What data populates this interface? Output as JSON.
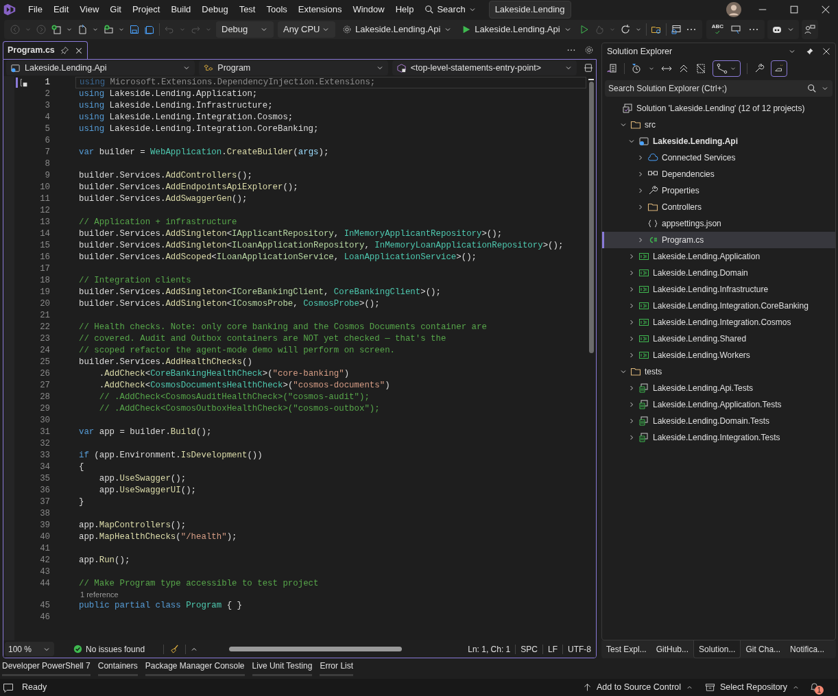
{
  "title_bar": {
    "menu": [
      "File",
      "Edit",
      "View",
      "Git",
      "Project",
      "Build",
      "Debug",
      "Test",
      "Tools",
      "Extensions",
      "Window",
      "Help"
    ],
    "search": "Search",
    "solution_name": "Lakeside.Lending"
  },
  "toolbar": {
    "configuration": "Debug",
    "platform": "Any CPU",
    "startup_project": "Lakeside.Lending.Api",
    "run_target": "Lakeside.Lending.Api",
    "spell_check": "ABC"
  },
  "editor": {
    "tab": {
      "label": "Program.cs",
      "selected": true
    },
    "nav": [
      "Lakeside.Lending.Api",
      "Program",
      "<top-level-statements-entry-point>"
    ],
    "lines": [
      {
        "kind": "code",
        "number": "1",
        "current": true,
        "tokens": [
          {
            "kind": "faded-keyword",
            "text": "using"
          },
          {
            "kind": "faded",
            "text": " Microsoft.Extensions.DependencyInjection.Extensions;"
          }
        ]
      },
      {
        "kind": "code",
        "number": "2",
        "current": false,
        "tokens": [
          {
            "kind": "keyword",
            "text": "using"
          },
          {
            "kind": "plain",
            "text": " Lakeside.Lending.Application;"
          }
        ]
      },
      {
        "kind": "code",
        "number": "3",
        "current": false,
        "tokens": [
          {
            "kind": "keyword",
            "text": "using"
          },
          {
            "kind": "plain",
            "text": " Lakeside.Lending.Infrastructure;"
          }
        ]
      },
      {
        "kind": "code",
        "number": "4",
        "current": false,
        "tokens": [
          {
            "kind": "keyword",
            "text": "using"
          },
          {
            "kind": "plain",
            "text": " Lakeside.Lending.Integration.Cosmos;"
          }
        ]
      },
      {
        "kind": "code",
        "number": "5",
        "current": false,
        "tokens": [
          {
            "kind": "keyword",
            "text": "using"
          },
          {
            "kind": "plain",
            "text": " Lakeside.Lending.Integration.CoreBanking;"
          }
        ]
      },
      {
        "kind": "code",
        "number": "6",
        "current": false
      },
      {
        "kind": "code",
        "number": "7",
        "current": false,
        "tokens": [
          {
            "kind": "keyword",
            "text": "var"
          },
          {
            "kind": "plain",
            "text": " builder = "
          },
          {
            "kind": "type",
            "text": "WebApplication"
          },
          {
            "kind": "plain",
            "text": "."
          },
          {
            "kind": "method",
            "text": "CreateBuilder"
          },
          {
            "kind": "plain",
            "text": "("
          },
          {
            "kind": "param",
            "text": "args"
          },
          {
            "kind": "plain",
            "text": ");"
          }
        ]
      },
      {
        "kind": "code",
        "number": "8",
        "current": false
      },
      {
        "kind": "code",
        "number": "9",
        "current": false,
        "tokens": [
          {
            "kind": "plain",
            "text": "builder.Services."
          },
          {
            "kind": "method",
            "text": "AddControllers"
          },
          {
            "kind": "plain",
            "text": "();"
          }
        ]
      },
      {
        "kind": "code",
        "number": "10",
        "current": false,
        "tokens": [
          {
            "kind": "plain",
            "text": "builder.Services."
          },
          {
            "kind": "method",
            "text": "AddEndpointsApiExplorer"
          },
          {
            "kind": "plain",
            "text": "();"
          }
        ]
      },
      {
        "kind": "code",
        "number": "11",
        "current": false,
        "tokens": [
          {
            "kind": "plain",
            "text": "builder.Services."
          },
          {
            "kind": "method",
            "text": "AddSwaggerGen"
          },
          {
            "kind": "plain",
            "text": "();"
          }
        ]
      },
      {
        "kind": "code",
        "number": "12",
        "current": false
      },
      {
        "kind": "code",
        "number": "13",
        "current": false,
        "tokens": [
          {
            "kind": "comment",
            "text": "// Application + infrastructure"
          }
        ]
      },
      {
        "kind": "code",
        "number": "14",
        "current": false,
        "tokens": [
          {
            "kind": "plain",
            "text": "builder.Services."
          },
          {
            "kind": "method",
            "text": "AddSingleton"
          },
          {
            "kind": "plain",
            "text": "<"
          },
          {
            "kind": "interface",
            "text": "IApplicantRepository"
          },
          {
            "kind": "plain",
            "text": ", "
          },
          {
            "kind": "type",
            "text": "InMemoryApplicantRepository"
          },
          {
            "kind": "plain",
            "text": ">();"
          }
        ]
      },
      {
        "kind": "code",
        "number": "15",
        "current": false,
        "tokens": [
          {
            "kind": "plain",
            "text": "builder.Services."
          },
          {
            "kind": "method",
            "text": "AddSingleton"
          },
          {
            "kind": "plain",
            "text": "<"
          },
          {
            "kind": "interface",
            "text": "ILoanApplicationRepository"
          },
          {
            "kind": "plain",
            "text": ", "
          },
          {
            "kind": "type",
            "text": "InMemoryLoanApplicationRepository"
          },
          {
            "kind": "plain",
            "text": ">();"
          }
        ]
      },
      {
        "kind": "code",
        "number": "16",
        "current": false,
        "tokens": [
          {
            "kind": "plain",
            "text": "builder.Services."
          },
          {
            "kind": "method",
            "text": "AddScoped"
          },
          {
            "kind": "plain",
            "text": "<"
          },
          {
            "kind": "interface",
            "text": "ILoanApplicationService"
          },
          {
            "kind": "plain",
            "text": ", "
          },
          {
            "kind": "type",
            "text": "LoanApplicationService"
          },
          {
            "kind": "plain",
            "text": ">();"
          }
        ]
      },
      {
        "kind": "code",
        "number": "17",
        "current": false
      },
      {
        "kind": "code",
        "number": "18",
        "current": false,
        "tokens": [
          {
            "kind": "comment",
            "text": "// Integration clients"
          }
        ]
      },
      {
        "kind": "code",
        "number": "19",
        "current": false,
        "tokens": [
          {
            "kind": "plain",
            "text": "builder.Services."
          },
          {
            "kind": "method",
            "text": "AddSingleton"
          },
          {
            "kind": "plain",
            "text": "<"
          },
          {
            "kind": "interface",
            "text": "ICoreBankingClient"
          },
          {
            "kind": "plain",
            "text": ", "
          },
          {
            "kind": "type",
            "text": "CoreBankingClient"
          },
          {
            "kind": "plain",
            "text": ">();"
          }
        ]
      },
      {
        "kind": "code",
        "number": "20",
        "current": false,
        "tokens": [
          {
            "kind": "plain",
            "text": "builder.Services."
          },
          {
            "kind": "method",
            "text": "AddSingleton"
          },
          {
            "kind": "plain",
            "text": "<"
          },
          {
            "kind": "interface",
            "text": "ICosmosProbe"
          },
          {
            "kind": "plain",
            "text": ", "
          },
          {
            "kind": "type",
            "text": "CosmosProbe"
          },
          {
            "kind": "plain",
            "text": ">();"
          }
        ]
      },
      {
        "kind": "code",
        "number": "21",
        "current": false
      },
      {
        "kind": "code",
        "number": "22",
        "current": false,
        "tokens": [
          {
            "kind": "comment",
            "text": "// Health checks. Note: only core banking and the Cosmos Documents container are"
          }
        ]
      },
      {
        "kind": "code",
        "number": "23",
        "current": false,
        "tokens": [
          {
            "kind": "comment",
            "text": "// covered. Audit and Outbox containers are NOT yet checked — that's the"
          }
        ]
      },
      {
        "kind": "code",
        "number": "24",
        "current": false,
        "tokens": [
          {
            "kind": "comment",
            "text": "// scoped refactor the agent-mode demo will perform on screen."
          }
        ]
      },
      {
        "kind": "code",
        "number": "25",
        "current": false,
        "tokens": [
          {
            "kind": "plain",
            "text": "builder.Services."
          },
          {
            "kind": "method",
            "text": "AddHealthChecks"
          },
          {
            "kind": "plain",
            "text": "()"
          }
        ]
      },
      {
        "kind": "code",
        "number": "26",
        "current": false,
        "tokens": [
          {
            "kind": "plain",
            "text": "    ."
          },
          {
            "kind": "method",
            "text": "AddCheck"
          },
          {
            "kind": "plain",
            "text": "<"
          },
          {
            "kind": "type",
            "text": "CoreBankingHealthCheck"
          },
          {
            "kind": "plain",
            "text": ">("
          },
          {
            "kind": "string",
            "text": "\"core-banking\""
          },
          {
            "kind": "plain",
            "text": ")"
          }
        ]
      },
      {
        "kind": "code",
        "number": "27",
        "current": false,
        "tokens": [
          {
            "kind": "plain",
            "text": "    ."
          },
          {
            "kind": "method",
            "text": "AddCheck"
          },
          {
            "kind": "plain",
            "text": "<"
          },
          {
            "kind": "type",
            "text": "CosmosDocumentsHealthCheck"
          },
          {
            "kind": "plain",
            "text": ">("
          },
          {
            "kind": "string",
            "text": "\"cosmos-documents\""
          },
          {
            "kind": "plain",
            "text": ")"
          }
        ]
      },
      {
        "kind": "code",
        "number": "28",
        "current": false,
        "tokens": [
          {
            "kind": "comment",
            "text": "    // .AddCheck<CosmosAuditHealthCheck>(\"cosmos-audit\");"
          }
        ]
      },
      {
        "kind": "code",
        "number": "29",
        "current": false,
        "tokens": [
          {
            "kind": "comment",
            "text": "    // .AddCheck<CosmosOutboxHealthCheck>(\"cosmos-outbox\");"
          }
        ]
      },
      {
        "kind": "code",
        "number": "30",
        "current": false
      },
      {
        "kind": "code",
        "number": "31",
        "current": false,
        "tokens": [
          {
            "kind": "keyword",
            "text": "var"
          },
          {
            "kind": "plain",
            "text": " app = builder."
          },
          {
            "kind": "method",
            "text": "Build"
          },
          {
            "kind": "plain",
            "text": "();"
          }
        ]
      },
      {
        "kind": "code",
        "number": "32",
        "current": false
      },
      {
        "kind": "code",
        "number": "33",
        "current": false,
        "tokens": [
          {
            "kind": "keyword",
            "text": "if"
          },
          {
            "kind": "plain",
            "text": " (app.Environment."
          },
          {
            "kind": "method",
            "text": "IsDevelopment"
          },
          {
            "kind": "plain",
            "text": "())"
          }
        ]
      },
      {
        "kind": "code",
        "number": "34",
        "current": false,
        "tokens": [
          {
            "kind": "plain",
            "text": "{"
          }
        ]
      },
      {
        "kind": "code",
        "number": "35",
        "current": false,
        "tokens": [
          {
            "kind": "plain",
            "text": "    app."
          },
          {
            "kind": "method",
            "text": "UseSwagger"
          },
          {
            "kind": "plain",
            "text": "();"
          }
        ]
      },
      {
        "kind": "code",
        "number": "36",
        "current": false,
        "tokens": [
          {
            "kind": "plain",
            "text": "    app."
          },
          {
            "kind": "method",
            "text": "UseSwaggerUI"
          },
          {
            "kind": "plain",
            "text": "();"
          }
        ]
      },
      {
        "kind": "code",
        "number": "37",
        "current": false,
        "tokens": [
          {
            "kind": "plain",
            "text": "}"
          }
        ]
      },
      {
        "kind": "code",
        "number": "38",
        "current": false
      },
      {
        "kind": "code",
        "number": "39",
        "current": false,
        "tokens": [
          {
            "kind": "plain",
            "text": "app."
          },
          {
            "kind": "method",
            "text": "MapControllers"
          },
          {
            "kind": "plain",
            "text": "();"
          }
        ]
      },
      {
        "kind": "code",
        "number": "40",
        "current": false,
        "tokens": [
          {
            "kind": "plain",
            "text": "app."
          },
          {
            "kind": "method",
            "text": "MapHealthChecks"
          },
          {
            "kind": "plain",
            "text": "("
          },
          {
            "kind": "string",
            "text": "\"/health\""
          },
          {
            "kind": "plain",
            "text": ");"
          }
        ]
      },
      {
        "kind": "code",
        "number": "41",
        "current": false
      },
      {
        "kind": "code",
        "number": "42",
        "current": false,
        "tokens": [
          {
            "kind": "plain",
            "text": "app."
          },
          {
            "kind": "method",
            "text": "Run"
          },
          {
            "kind": "plain",
            "text": "();"
          }
        ]
      },
      {
        "kind": "code",
        "number": "43",
        "current": false
      },
      {
        "kind": "code",
        "number": "44",
        "current": false,
        "tokens": [
          {
            "kind": "comment",
            "text": "// Make Program type accessible to test project"
          }
        ]
      },
      {
        "kind": "codelens",
        "text": "1 reference"
      },
      {
        "kind": "code",
        "number": "45",
        "current": false,
        "tokens": [
          {
            "kind": "keyword",
            "text": "public partial class "
          },
          {
            "kind": "type",
            "text": "Program"
          },
          {
            "kind": "plain",
            "text": " { }"
          }
        ]
      },
      {
        "kind": "code",
        "number": "46",
        "current": false
      }
    ]
  },
  "editor_status": {
    "zoom": "100 %",
    "issues": "No issues found",
    "position": "Ln: 1, Ch: 1",
    "indent": "SPC",
    "line_ending": "LF",
    "encoding": "UTF-8"
  },
  "solution_explorer": {
    "title": "Solution Explorer",
    "search_placeholder": "Search Solution Explorer (Ctrl+;)",
    "tree": [
      {
        "kind": "solution",
        "label": "Solution 'Lakeside.Lending' (12 of 12 projects)",
        "selected": false,
        "children": [
          {
            "kind": "folder",
            "label": "src",
            "selected": false,
            "expanded": true,
            "children": [
              {
                "kind": "webproject",
                "label": "Lakeside.Lending.Api",
                "selected": false,
                "expanded": true,
                "startup": true,
                "children": [
                  {
                    "kind": "connected",
                    "label": "Connected Services",
                    "selected": false,
                    "expanded": false
                  },
                  {
                    "kind": "dependencies",
                    "label": "Dependencies",
                    "selected": false,
                    "expanded": false
                  },
                  {
                    "kind": "properties",
                    "label": "Properties",
                    "selected": false,
                    "expanded": false
                  },
                  {
                    "kind": "folder",
                    "label": "Controllers",
                    "selected": false,
                    "expanded": false
                  },
                  {
                    "kind": "json",
                    "label": "appsettings.json",
                    "selected": false
                  },
                  {
                    "kind": "csharp",
                    "label": "Program.cs",
                    "selected": true,
                    "expanded": false
                  }
                ]
              },
              {
                "kind": "project",
                "label": "Lakeside.Lending.Application",
                "selected": false,
                "expanded": false,
                "startup": false
              },
              {
                "kind": "project",
                "label": "Lakeside.Lending.Domain",
                "selected": false,
                "expanded": false,
                "startup": false
              },
              {
                "kind": "project",
                "label": "Lakeside.Lending.Infrastructure",
                "selected": false,
                "expanded": false,
                "startup": false
              },
              {
                "kind": "project",
                "label": "Lakeside.Lending.Integration.CoreBanking",
                "selected": false,
                "expanded": false,
                "startup": false
              },
              {
                "kind": "project",
                "label": "Lakeside.Lending.Integration.Cosmos",
                "selected": false,
                "expanded": false,
                "startup": false
              },
              {
                "kind": "project",
                "label": "Lakeside.Lending.Shared",
                "selected": false,
                "expanded": false,
                "startup": false
              },
              {
                "kind": "project",
                "label": "Lakeside.Lending.Workers",
                "selected": false,
                "expanded": false,
                "startup": false
              }
            ]
          },
          {
            "kind": "folder",
            "label": "tests",
            "selected": false,
            "expanded": true,
            "children": [
              {
                "kind": "testproject",
                "label": "Lakeside.Lending.Api.Tests",
                "selected": false,
                "expanded": false,
                "startup": false
              },
              {
                "kind": "testproject",
                "label": "Lakeside.Lending.Application.Tests",
                "selected": false,
                "expanded": false,
                "startup": false
              },
              {
                "kind": "testproject",
                "label": "Lakeside.Lending.Domain.Tests",
                "selected": false,
                "expanded": false,
                "startup": false
              },
              {
                "kind": "testproject",
                "label": "Lakeside.Lending.Integration.Tests",
                "selected": false,
                "expanded": false,
                "startup": false
              }
            ]
          }
        ]
      }
    ]
  },
  "side_tabs": [
    {
      "label": "Test Expl...",
      "selected": false
    },
    {
      "label": "GitHub...",
      "selected": false
    },
    {
      "label": "Solution...",
      "selected": true
    },
    {
      "label": "Git Cha...",
      "selected": false
    },
    {
      "label": "Notifica...",
      "selected": false
    }
  ],
  "bottom_tabs": [
    "Developer PowerShell 7",
    "Containers",
    "Package Manager Console",
    "Live Unit Testing",
    "Error List"
  ],
  "status_bar": {
    "state": "Ready",
    "source_control": "Add to Source Control",
    "repository": "Select Repository",
    "notifications": "1"
  }
}
